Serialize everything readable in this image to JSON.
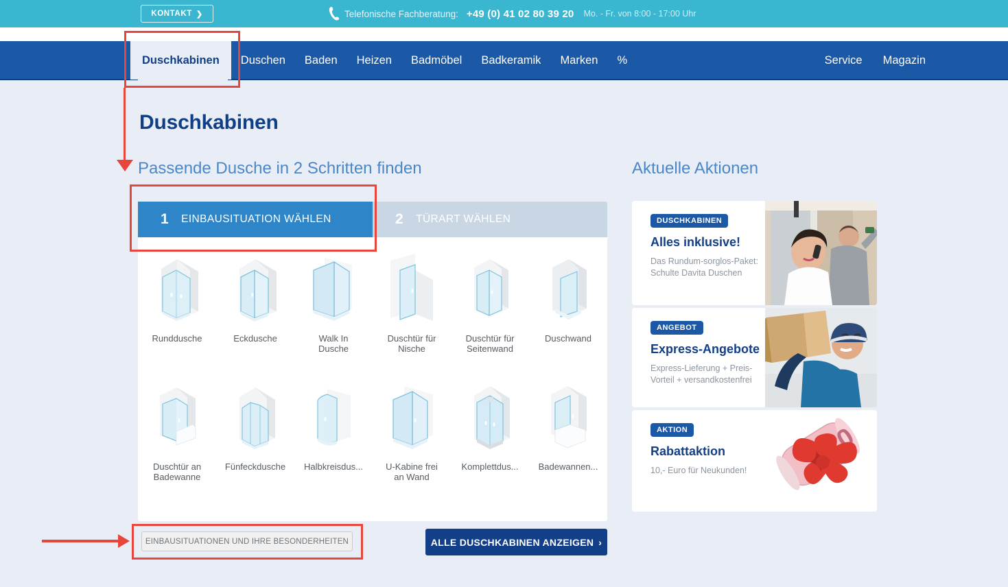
{
  "topbar": {
    "contact_button": "KONTAKT",
    "contact_chevron": "❯",
    "phone_icon": "phone-icon",
    "advice_label": "Telefonische Fachberatung:",
    "phone_number": "+49 (0) 41 02 80 39 20",
    "hours": "Mo. - Fr. von 8:00 - 17:00 Uhr",
    "bg_color": "#3ab6d0"
  },
  "nav": {
    "bg_color": "#1b58a6",
    "active_bg_color": "#e9eef6",
    "items": [
      {
        "label": "Duschkabinen",
        "active": true
      },
      {
        "label": "Duschen",
        "active": false
      },
      {
        "label": "Baden",
        "active": false
      },
      {
        "label": "Heizen",
        "active": false
      },
      {
        "label": "Badmöbel",
        "active": false
      },
      {
        "label": "Badkeramik",
        "active": false
      },
      {
        "label": "Marken",
        "active": false
      },
      {
        "label": "%",
        "active": false
      }
    ],
    "right_items": [
      {
        "label": "Service"
      },
      {
        "label": "Magazin"
      }
    ]
  },
  "page": {
    "title": "Duschkabinen",
    "subtitle": "Passende Dusche in 2 Schritten finden",
    "aktionen_title": "Aktuelle Aktionen",
    "background_color": "#e9eef6"
  },
  "wizard": {
    "tabs": [
      {
        "number": "1",
        "label": "EINBAUSITUATION WÄHLEN",
        "state": "active",
        "color": "#2e86c9"
      },
      {
        "number": "2",
        "label": "TÜRART WÄHLEN",
        "state": "inactive",
        "color": "#c9d7e4"
      }
    ],
    "options": [
      {
        "label": "Runddusche",
        "icon": "shower-round-icon"
      },
      {
        "label": "Eckdusche",
        "icon": "shower-corner-icon"
      },
      {
        "label": "Walk In\nDusche",
        "icon": "shower-walkin-icon"
      },
      {
        "label": "Duschtür für\nNische",
        "icon": "shower-niche-door-icon"
      },
      {
        "label": "Duschtür für\nSeitenwand",
        "icon": "shower-sidewall-door-icon"
      },
      {
        "label": "Duschwand",
        "icon": "shower-wall-icon"
      },
      {
        "label": "Duschtür an\nBadewanne",
        "icon": "shower-bathtub-door-icon"
      },
      {
        "label": "Fünfeckdusche",
        "icon": "shower-pentagon-icon"
      },
      {
        "label": "Halbkreisdus...",
        "icon": "shower-semicircle-icon"
      },
      {
        "label": "U-Kabine frei\nan Wand",
        "icon": "shower-ucabin-icon"
      },
      {
        "label": "Komplettdus...",
        "icon": "shower-complete-icon"
      },
      {
        "label": "Badewannen...",
        "icon": "shower-bathtub-screen-icon"
      }
    ]
  },
  "buttons": {
    "secondary": "EINBAUSITUATIONEN UND IHRE BESONDERHEITEN",
    "primary": "ALLE DUSCHKABINEN ANZEIGEN",
    "primary_chevron": "›"
  },
  "promos": [
    {
      "badge": "DUSCHKABINEN",
      "headline": "Alles inklusive!",
      "text": "Das Rundum-sorglos-Paket: Schulte Davita Duschen",
      "image": "woman-phone-installer-photo"
    },
    {
      "badge": "ANGEBOT",
      "headline": "Express-Angebote",
      "text": "Express-Lieferung + Preis-Vorteil + versandkostenfrei",
      "image": "delivery-man-box-photo"
    },
    {
      "badge": "AKTION",
      "headline": "Rabattaktion",
      "text": "10,- Euro für Neukunden!",
      "image": "money-roll-red-bow-photo"
    }
  ],
  "annotations": {
    "color": "#e8453c",
    "boxes": [
      "nav-duschkabinen",
      "step-1-tab",
      "besonderheiten-button"
    ],
    "arrows": [
      "nav-to-wizard-down-arrow",
      "pointer-to-besonderheiten-right-arrow"
    ]
  }
}
